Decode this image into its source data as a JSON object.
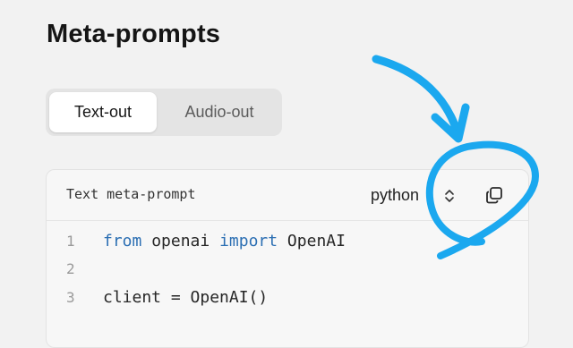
{
  "page": {
    "title": "Meta-prompts"
  },
  "tabs": [
    {
      "label": "Text-out",
      "active": true
    },
    {
      "label": "Audio-out",
      "active": false
    }
  ],
  "code_block": {
    "caption": "Text meta-prompt",
    "language": "python",
    "lines": [
      {
        "number": "1",
        "tokens": [
          {
            "t": "from",
            "kw": true
          },
          {
            "t": " openai ",
            "kw": false
          },
          {
            "t": "import",
            "kw": true
          },
          {
            "t": " OpenAI",
            "kw": false
          }
        ]
      },
      {
        "number": "2",
        "tokens": []
      },
      {
        "number": "3",
        "tokens": [
          {
            "t": "client = OpenAI()",
            "kw": false
          }
        ]
      }
    ]
  },
  "icons": {
    "language_toggle": "chevron-up-down-icon",
    "copy": "copy-icon"
  },
  "colors": {
    "annotation": "#1ba8ef",
    "keyword": "#2c6fb3",
    "background": "#f2f2f2"
  }
}
